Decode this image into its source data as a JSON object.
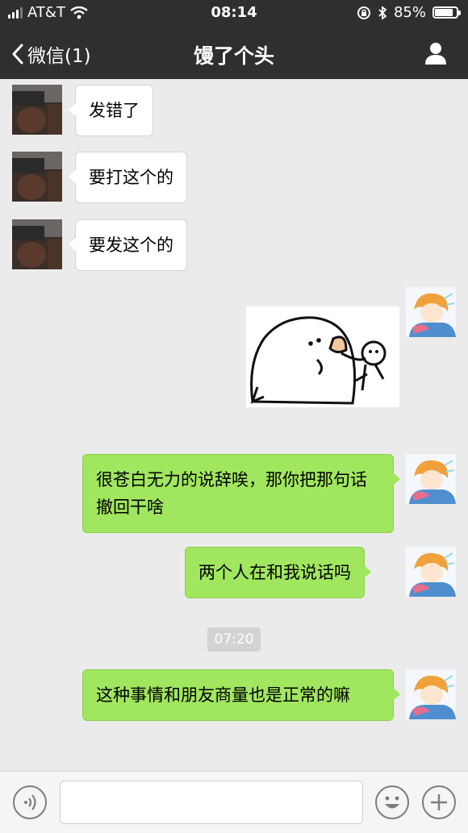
{
  "status_bar": {
    "carrier": "AT&T",
    "time": "08:14",
    "battery_percent": "85%",
    "battery_level": 0.85
  },
  "nav": {
    "back_label": "微信(1)",
    "title": "馒了个头"
  },
  "messages": [
    {
      "side": "left",
      "text": "发错了"
    },
    {
      "side": "left",
      "text": "要打这个的"
    },
    {
      "side": "left",
      "text": "要发这个的"
    },
    {
      "side": "right",
      "type": "sticker",
      "icon": "white-blob-sticker-icon"
    },
    {
      "side": "right",
      "text": "很苍白无力的说辞唉，那你把那句话撤回干啥"
    },
    {
      "side": "right",
      "text": "两个人在和我说话吗"
    },
    {
      "side": "right",
      "text": "这种事情和朋友商量也是正常的嘛"
    }
  ],
  "timestamp": "07:20",
  "input_bar": {
    "voice_icon": "voice-icon",
    "emoji_icon": "emoji-icon",
    "plus_icon": "plus-icon",
    "text_value": ""
  },
  "colors": {
    "bar": "#2f2f31",
    "background": "#ebebeb",
    "sent_bubble": "#a0e65f",
    "received_bubble": "#ffffff"
  }
}
